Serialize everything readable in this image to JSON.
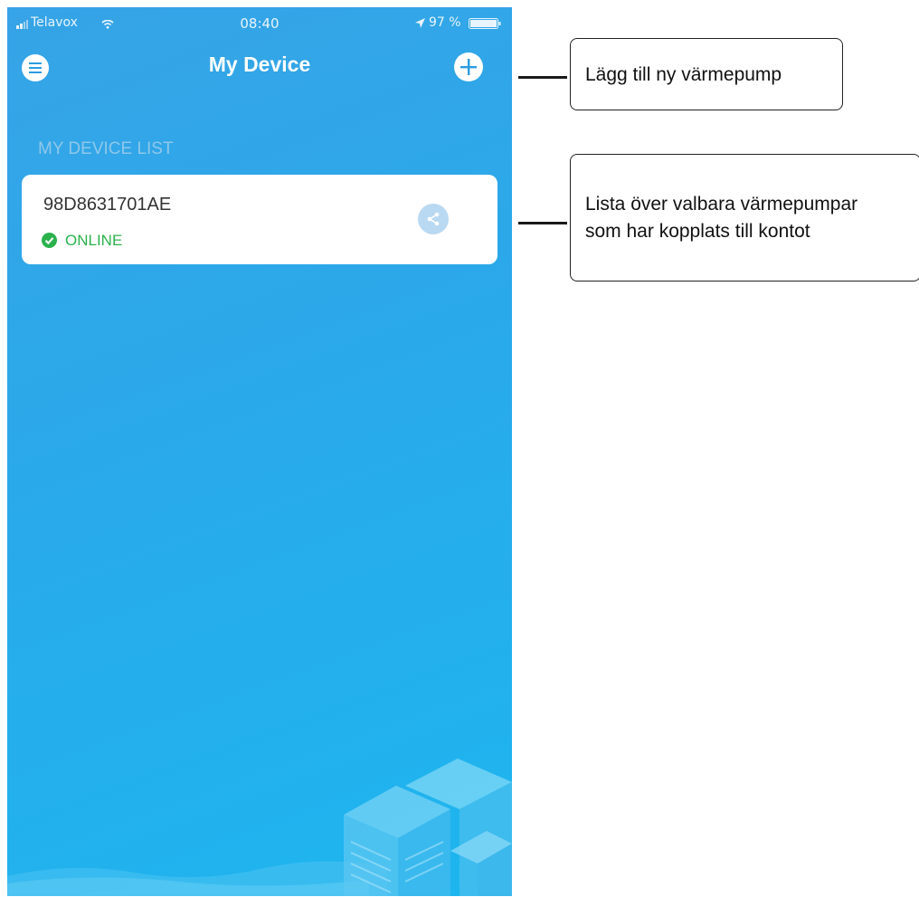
{
  "status_bar": {
    "carrier": "Telavox",
    "time": "08:40",
    "battery": "97 %"
  },
  "nav": {
    "title": "My Device",
    "menu_icon": "menu-icon",
    "add_icon": "plus-icon"
  },
  "device_list": {
    "header": "MY DEVICE LIST",
    "devices": [
      {
        "id": "98D8631701AE",
        "status": "ONLINE",
        "status_color": "#2bb24c",
        "share_icon": "share-icon"
      }
    ]
  },
  "annotations": {
    "add_device": "Lägg till ny värmepump",
    "device_list_line1": "Lista över valbara värmepumpar",
    "device_list_line2": "som har kopplats till kontot"
  },
  "colors": {
    "background_top": "#36a4e6",
    "background_bottom": "#1db6ef",
    "accent": "#2d9be0"
  }
}
